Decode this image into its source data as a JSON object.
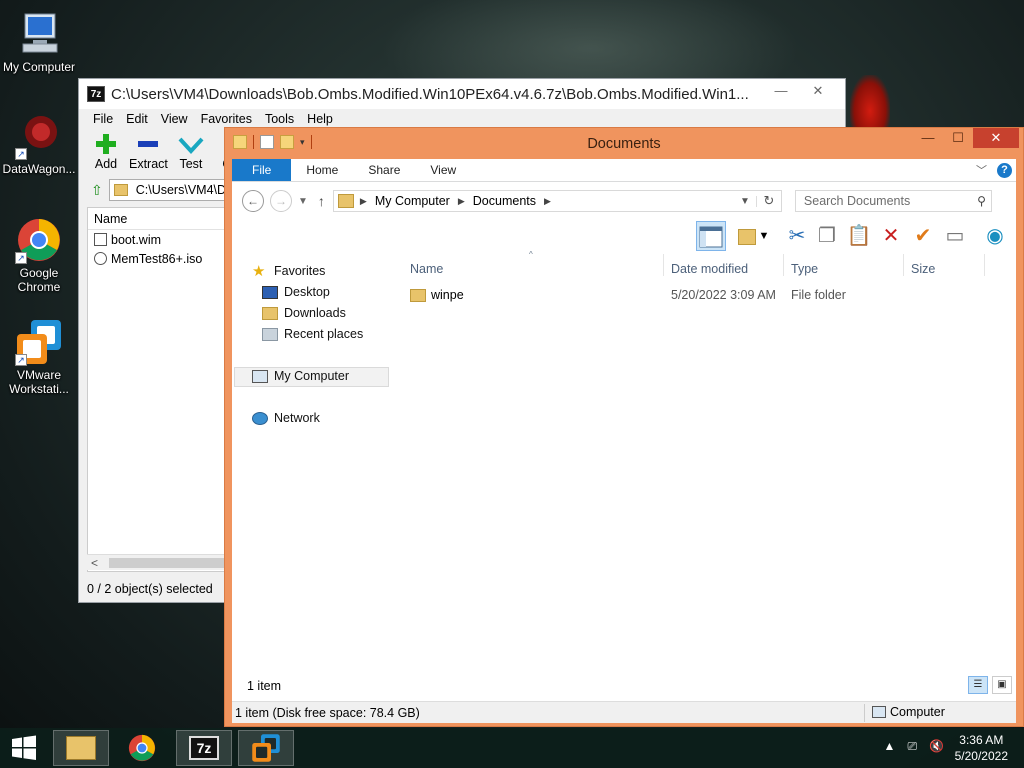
{
  "desktop": {
    "icons": [
      {
        "label": "My Computer",
        "icon": "computer-icon"
      },
      {
        "label": "DataWagon...",
        "icon": "datawagon-icon"
      },
      {
        "label": "Google Chrome",
        "icon": "chrome-icon"
      },
      {
        "label": "VMware Workstati...",
        "icon": "vmware-icon"
      }
    ]
  },
  "sevenzip": {
    "app_icon_text": "7z",
    "title": "C:\\Users\\VM4\\Downloads\\Bob.Ombs.Modified.Win10PEx64.v4.6.7z\\Bob.Ombs.Modified.Win1...",
    "minimize": "—",
    "close": "✕",
    "menu": [
      "File",
      "Edit",
      "View",
      "Favorites",
      "Tools",
      "Help"
    ],
    "toolbar": [
      "Add",
      "Extract",
      "Test",
      "C"
    ],
    "address": "C:\\Users\\VM4\\D",
    "column_name": "Name",
    "files": [
      {
        "name": "boot.wim",
        "icon": "wim-file-icon"
      },
      {
        "name": "MemTest86+.iso",
        "icon": "iso-file-icon"
      }
    ],
    "scroll_left": "<",
    "status": "0 / 2 object(s) selected"
  },
  "explorer": {
    "title": "Documents",
    "caption": {
      "minimize": "—",
      "maximize": "☐",
      "close": "✕"
    },
    "ribbon_tabs": [
      "File",
      "Home",
      "Share",
      "View"
    ],
    "help": "?",
    "breadcrumb": [
      "My Computer",
      "Documents"
    ],
    "search_placeholder": "Search Documents",
    "nav": {
      "favorites": "Favorites",
      "desktop": "Desktop",
      "downloads": "Downloads",
      "recent": "Recent places",
      "computer": "My Computer",
      "network": "Network"
    },
    "columns": [
      "Name",
      "Date modified",
      "Type",
      "Size"
    ],
    "rows": [
      {
        "name": "winpe",
        "date": "5/20/2022 3:09 AM",
        "type": "File folder",
        "size": ""
      }
    ],
    "item_count": "1 item",
    "status_left": "1 item (Disk free space: 78.4 GB)",
    "status_right": "Computer"
  },
  "taskbar": {
    "items": [
      "start-icon",
      "file-explorer-icon",
      "chrome-icon",
      "7zip-icon",
      "vmware-icon"
    ],
    "sevenzip_label": "7z",
    "time": "3:36 AM",
    "date": "5/20/2022"
  }
}
